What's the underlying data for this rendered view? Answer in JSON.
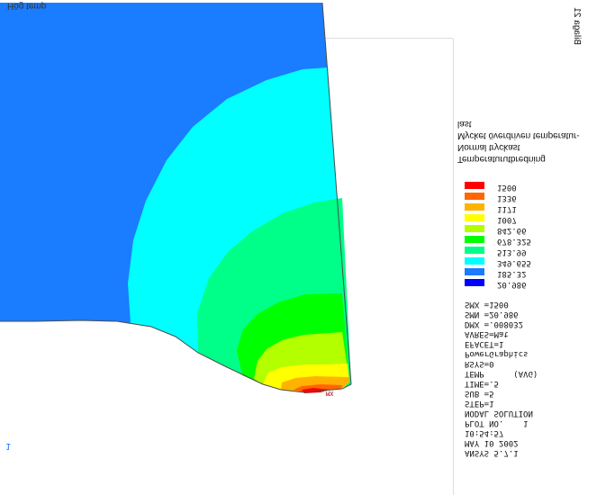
{
  "viewport_label": "Hög temp",
  "corner_mark": "1",
  "plot_info": {
    "title": "ANSYS 5.7.1",
    "date": "MAY 10 2002",
    "time": "10:54:57",
    "plot_no": "PLOT NO.    1",
    "solution": "NODAL SOLUTION",
    "step": "STEP=1",
    "sub": "SUB =5",
    "time_value": "TIME=.5",
    "temp": "TEMP      (AVG)",
    "rsys": "RSYS=0",
    "graphics": "PowerGraphics",
    "efacet": "EFACET=1",
    "avres": "AVRES=Mat",
    "dmx": "DMX =.008032",
    "smn": "SMN =20.986",
    "smx": "SMX =1500"
  },
  "legend": {
    "items": [
      {
        "label": "20.986",
        "color": "#0000ff"
      },
      {
        "label": "185.32",
        "color": "#1a7cff"
      },
      {
        "label": "349.655",
        "color": "#00ffff"
      },
      {
        "label": "513.99",
        "color": "#00ff88"
      },
      {
        "label": "678.325",
        "color": "#00ff00"
      },
      {
        "label": "842.66",
        "color": "#b3ff00"
      },
      {
        "label": "1007",
        "color": "#ffff00"
      },
      {
        "label": "1171",
        "color": "#ffb300"
      },
      {
        "label": "1336",
        "color": "#ff6600"
      },
      {
        "label": "1500",
        "color": "#ff0000"
      }
    ]
  },
  "description": {
    "line1": "Temperaturutbredning",
    "line2": "Normal tryckast",
    "line3": "Mycket överdriven temperatur-",
    "line4": "last"
  },
  "page_label": "Bilaga 21",
  "marker_label": "MX"
}
